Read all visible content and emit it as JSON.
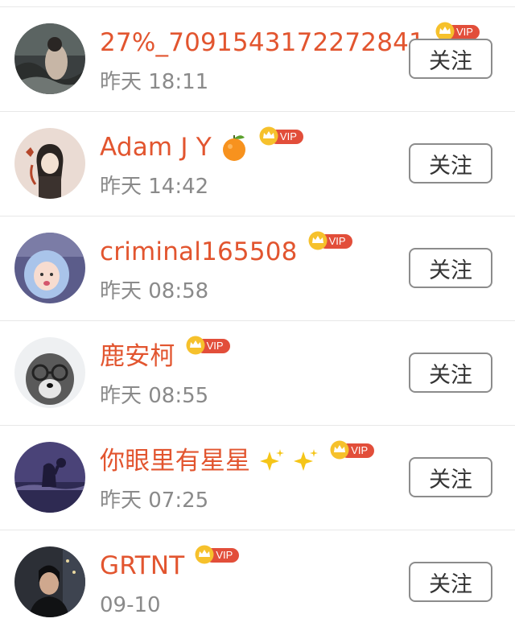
{
  "users": [
    {
      "name": "27%_7091543172272841",
      "time": "昨天 18:11",
      "badge": "VIP",
      "follow_label": "关注",
      "emoji": ""
    },
    {
      "name": "Adam J Y",
      "time": "昨天 14:42",
      "badge": "VIP",
      "follow_label": "关注",
      "emoji": "tangerine-emoji"
    },
    {
      "name": "criminal165508",
      "time": "昨天 08:58",
      "badge": "VIP",
      "follow_label": "关注",
      "emoji": ""
    },
    {
      "name": "鹿安柯",
      "time": "昨天 08:55",
      "badge": "VIP",
      "follow_label": "关注",
      "emoji": ""
    },
    {
      "name": "你眼里有星星",
      "time": "昨天 07:25",
      "badge": "VIP",
      "follow_label": "关注",
      "emoji": "sparkles-emoji"
    },
    {
      "name": "GRTNT",
      "time": "09-10",
      "badge": "VIP",
      "follow_label": "关注",
      "emoji": ""
    }
  ],
  "colors": {
    "username": "#e2552f",
    "timestamp": "#8a8a8a",
    "vip_badge": "#e24e3a",
    "crown": "#f6c12c",
    "button_border": "#8c8c8c",
    "divider": "#e8e8e8"
  }
}
